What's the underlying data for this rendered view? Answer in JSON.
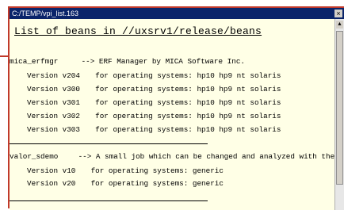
{
  "window": {
    "title": "C:/TEMP/vpi_list.163",
    "close_glyph": "×"
  },
  "document": {
    "heading": "List of beans in //uxsrv1/release/beans",
    "beans": [
      {
        "name": "mica_erfmgr",
        "description": "--> ERF Manager by MICA Software Inc.",
        "versions": [
          {
            "version": "Version v204",
            "systems": "for operating systems: hp10 hp9 nt solaris"
          },
          {
            "version": "Version v300",
            "systems": "for operating systems: hp10 hp9 nt solaris"
          },
          {
            "version": "Version v301",
            "systems": "for operating systems: hp10 hp9 nt solaris"
          },
          {
            "version": "Version v302",
            "systems": "for operating systems: hp10 hp9 nt solaris"
          },
          {
            "version": "Version v303",
            "systems": "for operating systems: hp10 hp9 nt solaris"
          }
        ]
      },
      {
        "name": "valor_sdemo",
        "description": "--> A small job which can be changed and analyzed with the demo version",
        "versions": [
          {
            "version": "Version v10",
            "systems": "for operating systems: generic"
          },
          {
            "version": "Version v20",
            "systems": "for operating systems: generic"
          }
        ]
      }
    ]
  },
  "icons": {
    "scroll_up": "up-arrow-icon"
  },
  "colors": {
    "titlebar": "#0a246a",
    "content_background": "#ffffe6",
    "frame_accent": "#c0392b"
  }
}
